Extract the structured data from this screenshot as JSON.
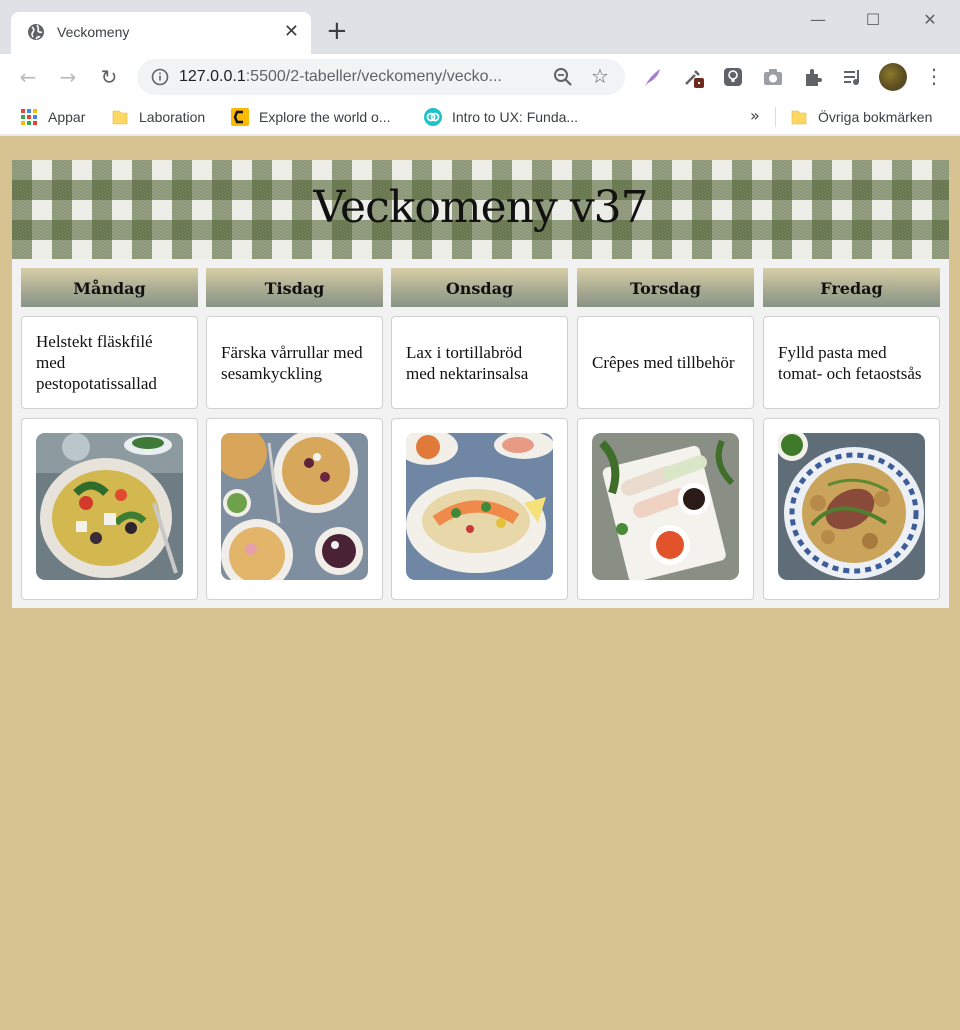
{
  "browser": {
    "tab_title": "Veckomeny",
    "tab_close": "✕",
    "new_tab": "+",
    "url_host": "127.0.0.1",
    "url_rest": ":5500/2-tabeller/veckomeny/vecko...",
    "back_icon": "←",
    "forward_icon": "→",
    "reload_icon": "↻",
    "star_icon": "☆",
    "menu_icon": "⋮",
    "minimize_icon": "—",
    "maximize_icon": "☐",
    "close_icon": "✕"
  },
  "bookmarks": {
    "items": [
      {
        "label": "Appar",
        "icon": "apps-grid-icon"
      },
      {
        "label": "Laboration",
        "icon": "folder-icon"
      },
      {
        "label": "Explore the world o...",
        "icon": "site-icon"
      },
      {
        "label": "Intro to UX: Funda...",
        "icon": "site-icon"
      }
    ],
    "overflow": "»",
    "other": "Övriga bokmärken"
  },
  "page": {
    "title": "Veckomeny v37",
    "days": [
      {
        "name": "Måndag",
        "dish": "Helstekt fläskfilé med pestopotatissallad"
      },
      {
        "name": "Tisdag",
        "dish": "Färska vårrullar med sesamkyckling"
      },
      {
        "name": "Onsdag",
        "dish": "Lax i tortillabröd med nektarinsalsa"
      },
      {
        "name": "Torsdag",
        "dish": "Crêpes med tillbehör"
      },
      {
        "name": "Fredag",
        "dish": "Fylld pasta med tomat- och fetaostsås"
      }
    ]
  },
  "colors": {
    "page_background": "#d6c391",
    "card_background": "#f2f2f2",
    "gingham_green": "#506230"
  }
}
